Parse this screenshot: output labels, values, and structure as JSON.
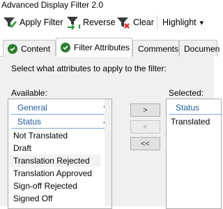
{
  "window": {
    "title": "Advanced Display Filter 2.0"
  },
  "toolbar": {
    "apply_label": "Apply Filter",
    "reverse_label": "Reverse",
    "clear_label": "Clear",
    "highlight_label": "Highlight",
    "highlight_caret": "▾"
  },
  "tabs": [
    {
      "label": "Content",
      "active": false
    },
    {
      "label": "Filter Attributes",
      "active": true
    },
    {
      "label": "Comments",
      "active": false
    },
    {
      "label": "Documen",
      "active": false
    }
  ],
  "panel": {
    "instruction": "Select what attributes to apply to the filter:",
    "available_label": "Available:",
    "selected_label": "Selected:"
  },
  "available": {
    "groups": [
      {
        "label": "General",
        "expanded": false
      },
      {
        "label": "Status",
        "expanded": true
      }
    ],
    "items": [
      "Not Translated",
      "Draft",
      "Translation Rejected",
      "Translation Approved",
      "Sign-off Rejected",
      "Signed Off"
    ],
    "selected_index": 2
  },
  "buttons": {
    "add": ">",
    "remove": "<",
    "remove_all": "<<"
  },
  "selected": {
    "group": "Status",
    "items": [
      "Translated"
    ]
  },
  "colors": {
    "group_text": "#1f5b9a",
    "check_green": "#2e7d32",
    "panel_bg": "#f0f0f0"
  }
}
